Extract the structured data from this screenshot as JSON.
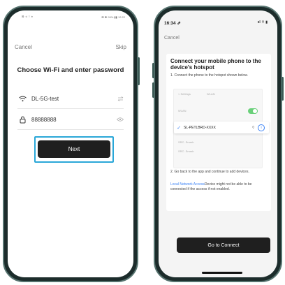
{
  "left_screen": {
    "status_bar": {
      "left": "⊠ ◦ıl ⌔ ♦",
      "right": "⊠ ✱ 99% ▮▮ 12:22"
    },
    "nav": {
      "cancel": "Cancel",
      "skip": "Skip"
    },
    "title": "Choose Wi-Fi and enter password",
    "wifi_field": {
      "value": "DL-5G-test",
      "icon": "wifi-icon",
      "tail_icon": "switch-arrows-icon"
    },
    "password_field": {
      "value": "88888888",
      "icon": "lock-icon",
      "tail_icon": "eye-icon"
    },
    "next_button": "Next",
    "highlight_color": "#2aa7d8"
  },
  "right_screen": {
    "status_bar": {
      "time": "16:34 ⇗",
      "icons": "ııl ⌔ ▮"
    },
    "nav": {
      "cancel": "Cancel"
    },
    "heading": "Connect your mobile phone to the device's hotspot",
    "step1": "1. Connect the phone to the hotspot shown below.",
    "mini_settings": {
      "back": "< Settings",
      "header": "WLAN",
      "row_wlan": "WLAN",
      "selected_ssid": "SL-PETLBRD-XXXX",
      "other_1": "SRC. Smarb",
      "other_2": "SRC. Smarb"
    },
    "step2": "2. Go back to the app and continue to add devices.",
    "note_link": "Local Network Access",
    "note_rest": "Device might not be able to be connected if the access if not enabled.",
    "go_button": "Go to Connect"
  },
  "colors": {
    "accent_blue": "#3b82f6",
    "toggle_green": "#6ad07a",
    "button_dark": "#1f1f1f",
    "phone_frame": "#1c2c2b"
  }
}
